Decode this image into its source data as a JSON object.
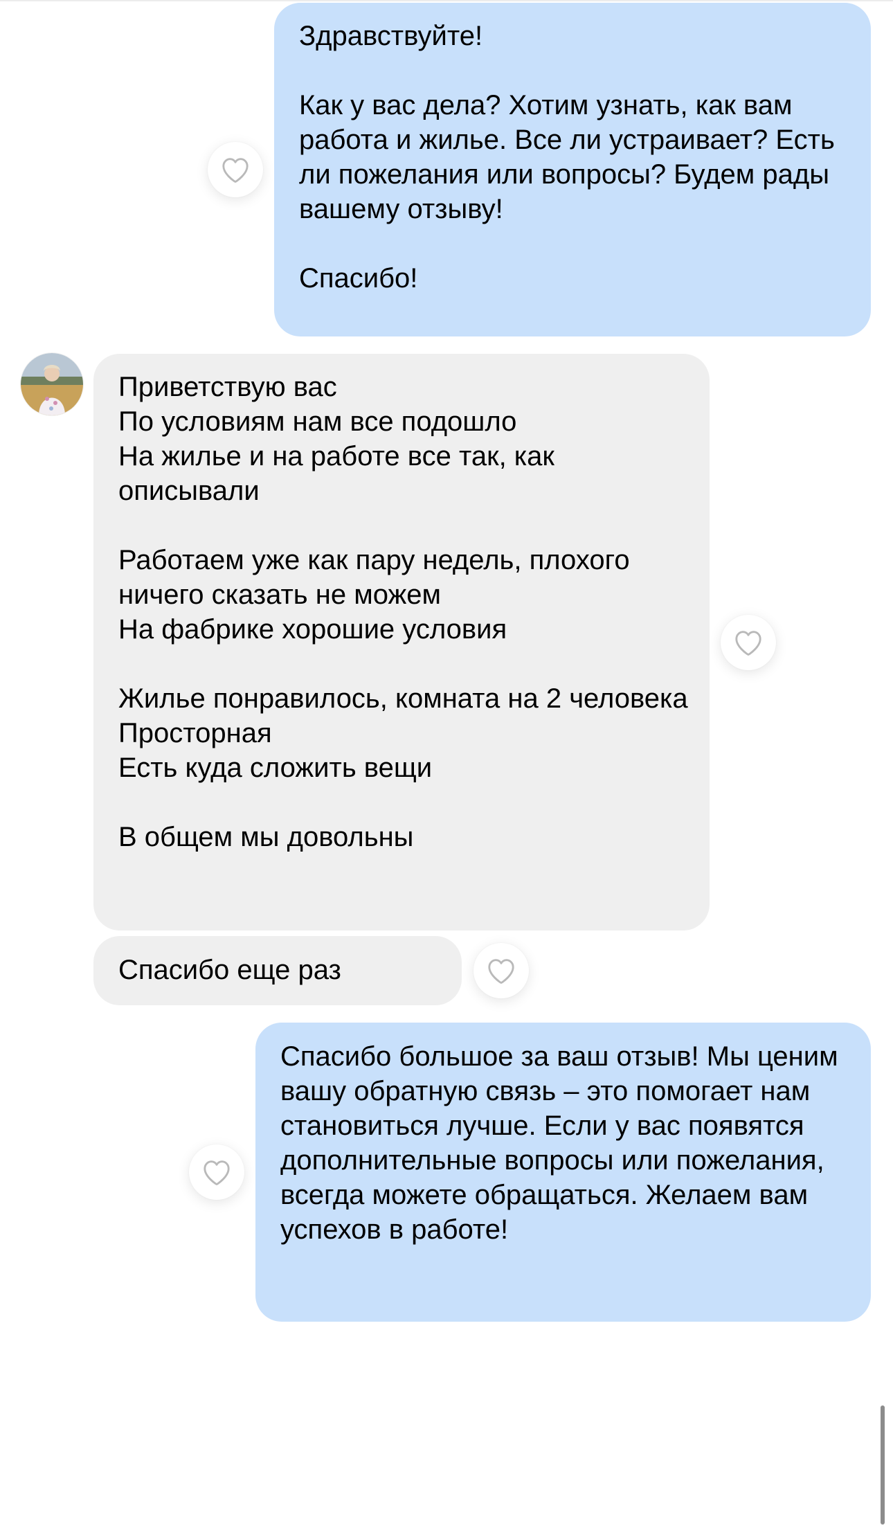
{
  "colors": {
    "outgoing_bubble": "#c8e0fb",
    "incoming_bubble": "#efefef",
    "like_icon_stroke": "#b9b9b9"
  },
  "icons": {
    "like": "heart-outline-icon",
    "avatar": "user-avatar-photo"
  },
  "messages": [
    {
      "direction": "outgoing",
      "text": "Здравствуйте!\n\nКак у вас дела? Хотим узнать, как вам работа и жилье. Все ли устраивает? Есть ли пожелания или вопросы? Будем рады вашему отзыву!\n\nСпасибо!"
    },
    {
      "direction": "incoming",
      "text": "Приветствую вас\nПо условиям нам все подошло\nНа жилье и на работе все так, как описывали\n\nРаботаем уже как пару недель, плохого ничего сказать не можем\nНа фабрике хорошие условия\n\nЖилье понравилось, комната на 2 человека\nПросторная\nЕсть куда сложить вещи\n\nВ общем мы довольны"
    },
    {
      "direction": "incoming",
      "text": "Спасибо еще раз"
    },
    {
      "direction": "outgoing",
      "text": "Спасибо большое за ваш отзыв! Мы ценим вашу обратную связь – это помогает нам становиться лучше. Если у вас появятся дополнительные вопросы или пожелания, всегда можете обращаться. Желаем вам успехов в работе!"
    }
  ]
}
